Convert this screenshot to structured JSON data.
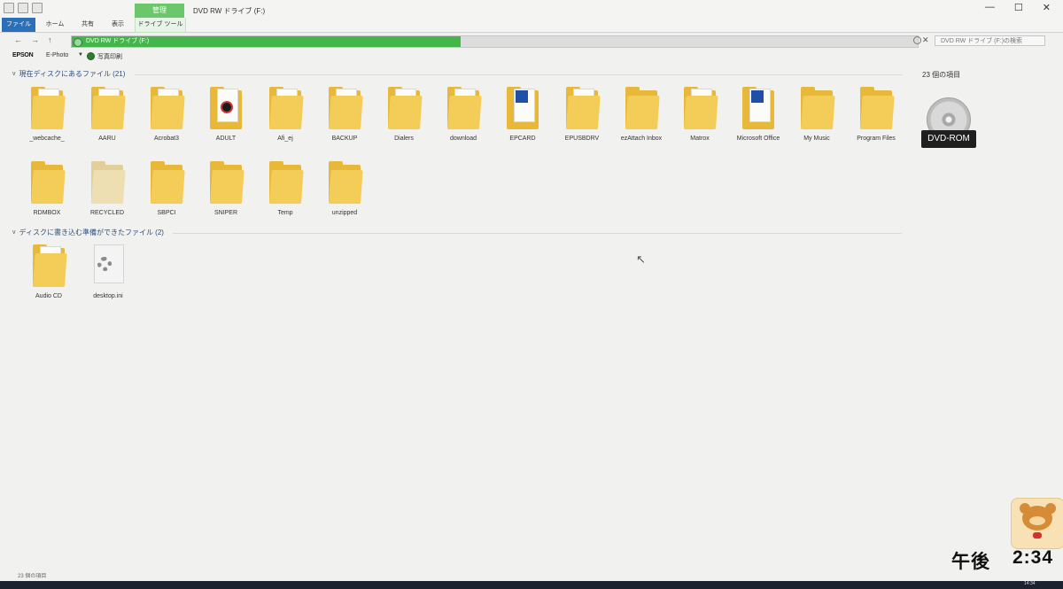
{
  "window": {
    "title": "DVD RW ドライブ (F:)",
    "context_tab": "管理",
    "minimize": "—",
    "maximize": "☐",
    "close": "✕"
  },
  "ribbon": {
    "tabs": [
      {
        "label": "ファイル"
      },
      {
        "label": "ホーム"
      },
      {
        "label": "共有"
      },
      {
        "label": "表示"
      },
      {
        "label": "ドライブ ツール"
      }
    ]
  },
  "address": {
    "path": "DVD RW ドライブ (F:)",
    "progress": 0.46,
    "search_placeholder": "DVD RW ドライブ (F:)の検索"
  },
  "toolbar": {
    "brand": "EPSON",
    "app": "E-Photo",
    "dropdown": "▼",
    "print_label": "写真印刷"
  },
  "groups": [
    {
      "label": "現在ディスクにあるファイル (21)"
    },
    {
      "label": "ディスクに書き込む準備ができたファイル (2)"
    }
  ],
  "files": [
    "_webcache_",
    "AARU",
    "Acrobat3",
    "ADULT",
    "Afi_ej",
    "BACKUP",
    "Dialers",
    "download",
    "EPCARD",
    "EPUSBDRV",
    "ezAttach Inbox",
    "Matrox",
    "Microsoft Office",
    "My Music",
    "Program Files",
    "RDMBOX",
    "RECYCLED",
    "SBPCI",
    "SNIPER",
    "Temp",
    "unzipped",
    "Audio CD",
    "desktop.ini"
  ],
  "sidebar": {
    "count": "23 個の項目",
    "drive_label": "DVD-ROM"
  },
  "status": {
    "text": "23 個の項目"
  },
  "overlay": {
    "period": "午後",
    "time": "2:34"
  },
  "taskbar": {
    "tray_time": "14:34"
  }
}
